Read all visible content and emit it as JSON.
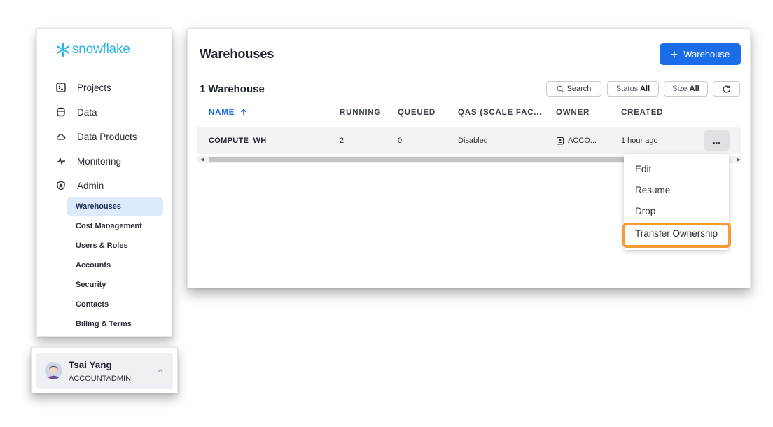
{
  "brand": {
    "name": "snowflake",
    "color": "#29b5e8"
  },
  "sidebar": {
    "nav": [
      {
        "label": "Projects",
        "icon": "terminal-icon"
      },
      {
        "label": "Data",
        "icon": "database-icon"
      },
      {
        "label": "Data Products",
        "icon": "cloud-icon"
      },
      {
        "label": "Monitoring",
        "icon": "activity-icon"
      },
      {
        "label": "Admin",
        "icon": "shield-icon"
      }
    ],
    "admin_items": [
      "Warehouses",
      "Cost Management",
      "Users & Roles",
      "Accounts",
      "Security",
      "Contacts",
      "Billing & Terms"
    ],
    "active_item": "Warehouses"
  },
  "user": {
    "name": "Tsai Yang",
    "role": "ACCOUNTADMIN"
  },
  "main": {
    "title": "Warehouses",
    "add_button": {
      "plus": "+",
      "label": "Warehouse"
    },
    "count_label": "1 Warehouse",
    "toolbar": {
      "search": "Search",
      "status_label": "Status",
      "status_value": "All",
      "size_label": "Size",
      "size_value": "All"
    },
    "table": {
      "columns": [
        "NAME",
        "RUNNING",
        "QUEUED",
        "QAS (SCALE FAC...",
        "OWNER",
        "CREATED"
      ],
      "sort_column": "NAME",
      "rows": [
        {
          "name": "COMPUTE_WH",
          "running": "2",
          "queued": "0",
          "qas": "Disabled",
          "owner": "ACCO...",
          "created": "1 hour ago"
        }
      ],
      "row_actions_label": "..."
    }
  },
  "menu": {
    "items": [
      "Edit",
      "Resume",
      "Drop",
      "Transfer Ownership"
    ],
    "highlighted": "Transfer Ownership",
    "highlight_color": "#f59a34"
  },
  "colors": {
    "accent": "#1a6ce8",
    "active_bg": "#dceafb"
  }
}
